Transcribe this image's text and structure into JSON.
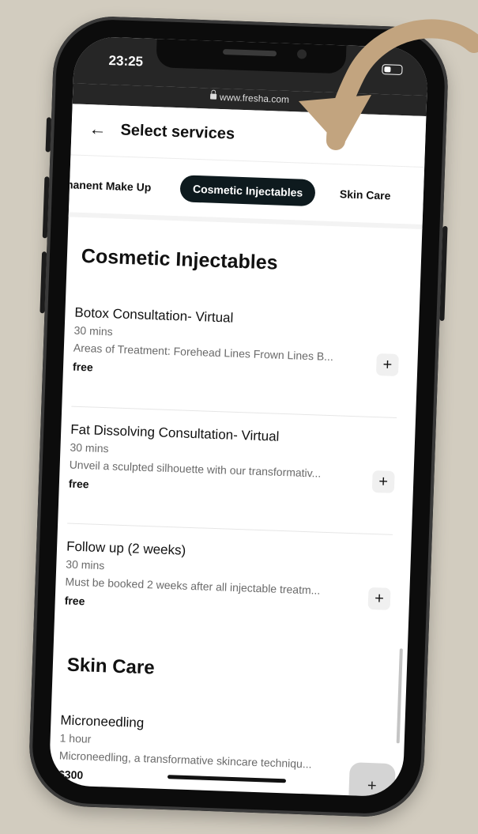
{
  "status": {
    "time": "23:25"
  },
  "browser": {
    "url": "www.fresha.com"
  },
  "header": {
    "title": "Select services"
  },
  "tabs": [
    {
      "label": "manent Make Up"
    },
    {
      "label": "Cosmetic Injectables"
    },
    {
      "label": "Skin Care"
    }
  ],
  "sections": [
    {
      "title": "Cosmetic Injectables",
      "services": [
        {
          "name": "Botox Consultation- Virtual",
          "duration": "30 mins",
          "description": "Areas of Treatment: Forehead Lines Frown Lines B...",
          "price": "free",
          "add": "+"
        },
        {
          "name": "Fat Dissolving Consultation- Virtual",
          "duration": "30 mins",
          "description": "Unveil a sculpted silhouette with our transformativ...",
          "price": "free",
          "add": "+"
        },
        {
          "name": "Follow up (2 weeks)",
          "duration": "30 mins",
          "description": "Must be booked 2 weeks after all injectable treatm...",
          "price": "free",
          "add": "+"
        }
      ]
    },
    {
      "title": "Skin Care",
      "services": [
        {
          "name": "Microneedling",
          "duration": "1 hour",
          "description": "Microneedling, a transformative skincare techniqu...",
          "price": "$300",
          "add": "+"
        }
      ]
    }
  ],
  "fab": {
    "label": "+"
  },
  "colors": {
    "background": "#d2ccbf",
    "arrow": "#c2a47f",
    "active_tab": "#0e1a1e",
    "status_bar": "#262626"
  }
}
